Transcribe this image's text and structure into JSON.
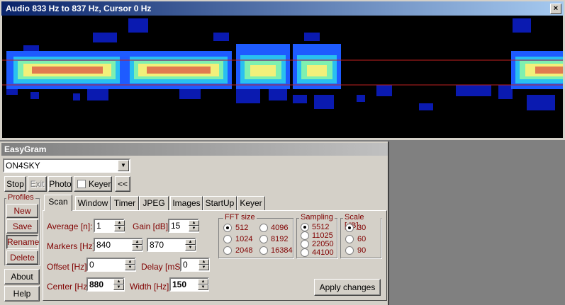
{
  "spectrogram": {
    "title": "Audio 833 Hz to 837 Hz, Cursor 0 Hz",
    "close_glyph": "×"
  },
  "easygram": {
    "title": "EasyGram",
    "callsign": "ON4SKY",
    "buttons": {
      "stop": "Stop",
      "exit": "Exit",
      "photo": "Photo",
      "keyer": "Keyer",
      "collapse": "<<"
    },
    "profiles": {
      "title": "Profiles",
      "new": "New",
      "save": "Save",
      "rename": "Rename",
      "delete": "Delete"
    },
    "about": "About",
    "help": "Help",
    "tabs": [
      "Scan",
      "Window",
      "Timer",
      "JPEG",
      "Images",
      "StartUp",
      "Keyer"
    ],
    "scan": {
      "average_label": "Average [n]:",
      "average": "1",
      "gain_label": "Gain [dB]:",
      "gain": "15",
      "markers_label": "Markers [Hz]:",
      "marker1": "840",
      "marker2": "870",
      "offset_label": "Offset [Hz]:",
      "offset": "0",
      "delay_label": "Delay [mS]:",
      "delay": "0",
      "center_label": "Center [Hz]:",
      "center": "880",
      "width_label": "Width [Hz]:",
      "width": "150"
    },
    "fft": {
      "title": "FFT size",
      "options": [
        "512",
        "4096",
        "1024",
        "8192",
        "2048",
        "16384"
      ],
      "selected": "512"
    },
    "sampling": {
      "title": "Sampling",
      "options": [
        "5512",
        "11025",
        "22050",
        "44100"
      ],
      "selected": "5512"
    },
    "scale": {
      "title": "Scale [dB]",
      "options": [
        "30",
        "60",
        "90"
      ],
      "selected": "30"
    },
    "apply": "Apply changes"
  },
  "colors": {
    "title_active": "#0a246a",
    "label_red": "#800000",
    "face": "#d4d0c8"
  }
}
